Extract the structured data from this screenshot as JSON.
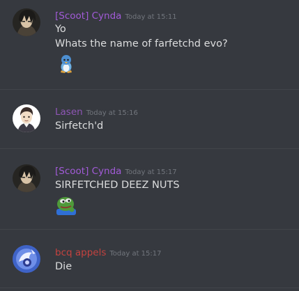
{
  "colors": {
    "background": "#36393f",
    "text": "#dcddde",
    "timestamp": "#72767d",
    "purple_role": "#a25bd8",
    "lavender_role": "#8e56b5",
    "red_role": "#c4423f"
  },
  "messages": [
    {
      "author": "[Scoot] Cynda",
      "author_color": "#a25bd8",
      "timestamp": "Today at 15:11",
      "lines": [
        "Yo",
        "Whats the name of farfetchd evo?"
      ],
      "emoji": "piplup-emoji"
    },
    {
      "author": "Lasen",
      "author_color": "#8e56b5",
      "timestamp": "Today at 15:16",
      "lines": [
        "Sirfetch'd"
      ]
    },
    {
      "author": "[Scoot] Cynda",
      "author_color": "#a25bd8",
      "timestamp": "Today at 15:17",
      "lines": [
        "SIRFETCHED DEEZ NUTS"
      ],
      "emoji": "pepe-emoji"
    },
    {
      "author": "bcq appels",
      "author_color": "#c4423f",
      "timestamp": "Today at 15:17",
      "lines": [
        "Die"
      ]
    }
  ]
}
